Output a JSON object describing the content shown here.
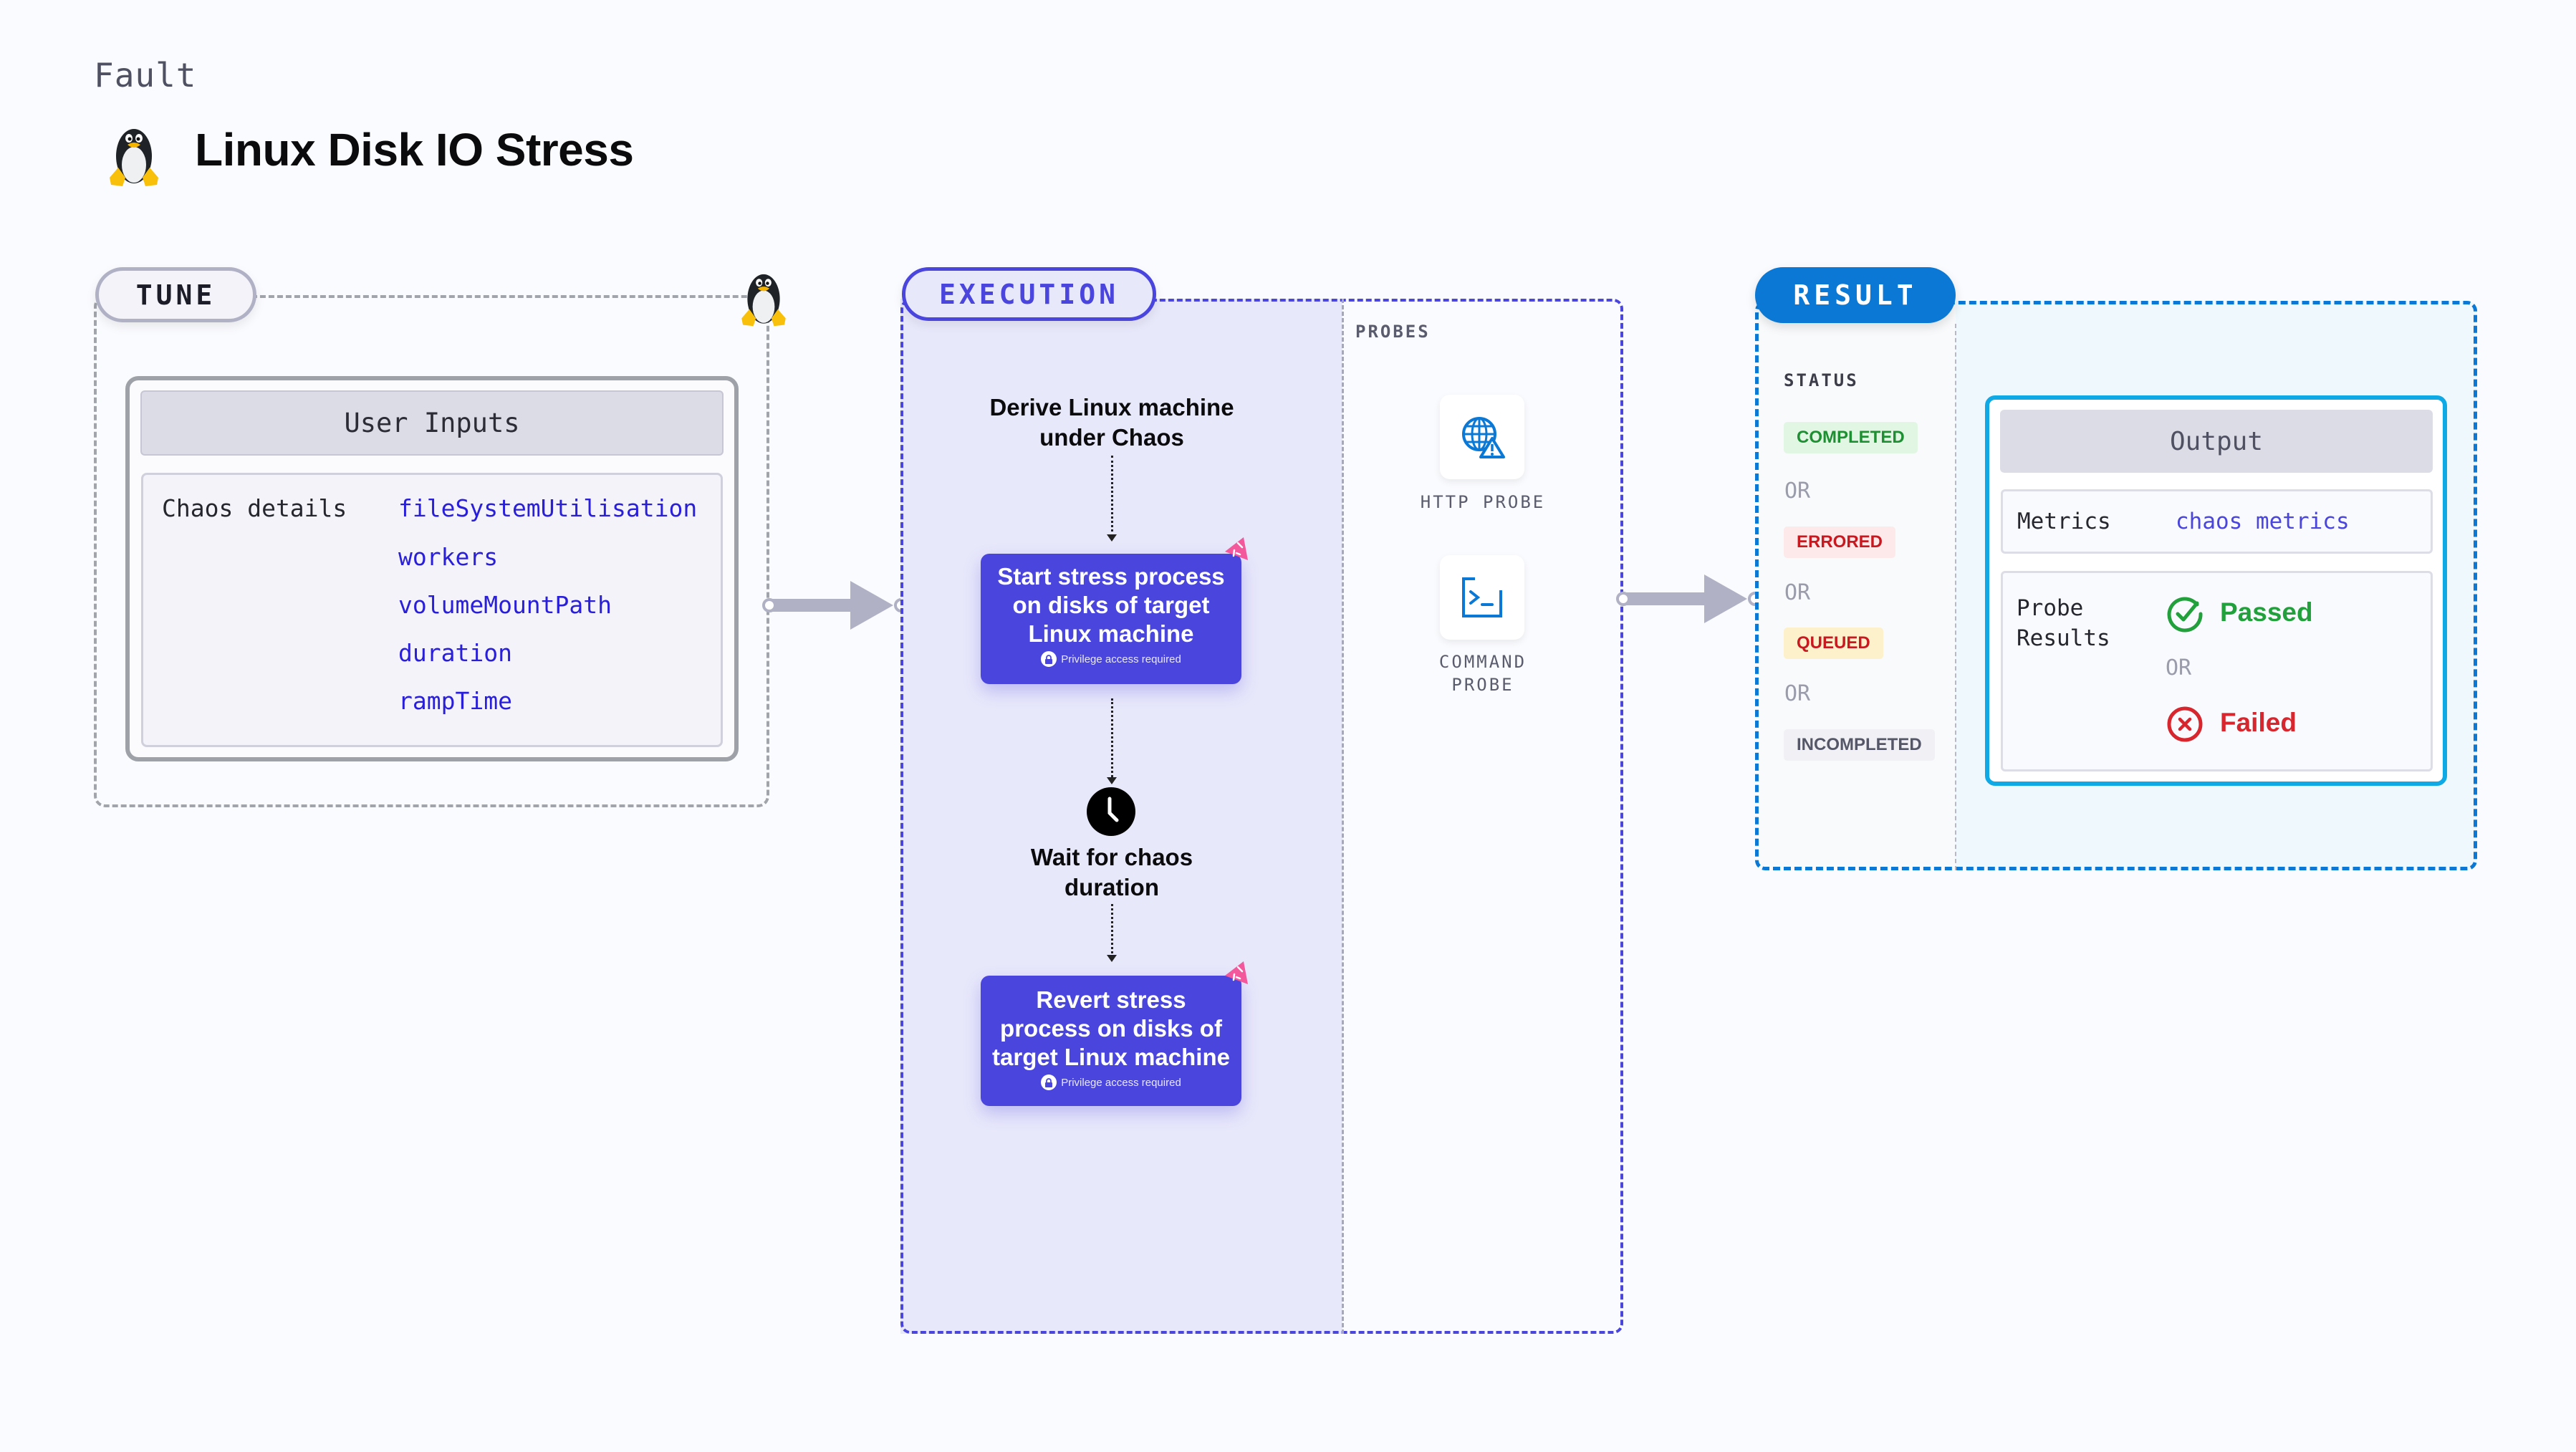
{
  "header": {
    "eyebrow": "Fault",
    "title": "Linux Disk IO Stress",
    "icon": "linux-penguin-icon"
  },
  "tune": {
    "label": "TUNE",
    "icon": "linux-penguin-icon",
    "user_inputs": {
      "title": "User Inputs",
      "row_label": "Chaos details",
      "params": [
        "fileSystemUtilisation",
        "workers",
        "volumeMountPath",
        "duration",
        "rampTime"
      ]
    }
  },
  "execution": {
    "label": "EXECUTION",
    "steps": [
      {
        "type": "text",
        "text": "Derive Linux machine under Chaos"
      },
      {
        "type": "card",
        "text": "Start stress process on disks of target Linux machine",
        "note": "Privilege access required"
      },
      {
        "type": "wait",
        "text": "Wait for chaos duration",
        "icon": "clock-icon"
      },
      {
        "type": "card",
        "text": "Revert stress process on disks of target Linux machine",
        "note": "Privilege access required"
      }
    ],
    "probes": {
      "label": "PROBES",
      "items": [
        {
          "label": "HTTP PROBE",
          "icon": "globe-warning-icon"
        },
        {
          "label": "COMMAND PROBE",
          "icon": "terminal-icon"
        }
      ]
    }
  },
  "result": {
    "label": "RESULT",
    "status_label": "STATUS",
    "or_text": "OR",
    "statuses": [
      {
        "label": "COMPLETED",
        "color": "#1e8f32",
        "bg": "#e2f6e4"
      },
      {
        "label": "ERRORED",
        "color": "#c7191f",
        "bg": "#fde9ea"
      },
      {
        "label": "QUEUED",
        "color": "#c7191f",
        "bg": "#fdf1cc"
      },
      {
        "label": "INCOMPLETED",
        "color": "#555768",
        "bg": "#f0f0f5"
      }
    ],
    "output": {
      "title": "Output",
      "metrics_label": "Metrics",
      "metrics_value": "chaos metrics",
      "probe_results_label": "Probe Results",
      "passed": "Passed",
      "failed": "Failed",
      "or_text": "OR"
    }
  },
  "colors": {
    "execution_accent": "#4a45dd",
    "result_accent": "#0a78d4",
    "output_border": "#0fa9e6",
    "param_text": "#2a1fd8",
    "passed": "#22a03c",
    "failed": "#d7262d"
  }
}
